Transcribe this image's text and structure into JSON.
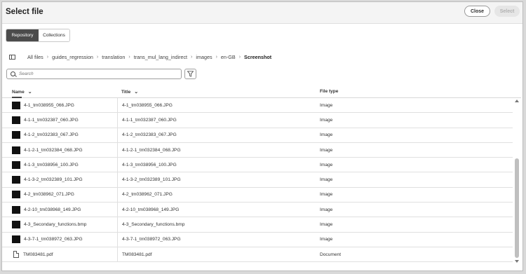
{
  "dialog": {
    "title": "Select file",
    "close_label": "Close",
    "select_label": "Select"
  },
  "tabs": [
    {
      "label": "Repository",
      "active": true
    },
    {
      "label": "Collections",
      "active": false
    }
  ],
  "breadcrumb": [
    "All files",
    "guides_regression",
    "translation",
    "trans_mul_lang_indirect",
    "images",
    "en-GB",
    "Screenshot"
  ],
  "search": {
    "placeholder": "Search",
    "value": ""
  },
  "table": {
    "columns": [
      "Name",
      "Title",
      "File type"
    ],
    "rows": [
      {
        "icon": "image-thumbnail",
        "name": "4-1_tm038955_066.JPG",
        "title": "4-1_tm038955_066.JPG",
        "type": "Image"
      },
      {
        "icon": "image-thumbnail",
        "name": "4-1-1_tm032387_060.JPG",
        "title": "4-1-1_tm032387_060.JPG",
        "type": "Image"
      },
      {
        "icon": "image-thumbnail",
        "name": "4-1-2_tm032383_067.JPG",
        "title": "4-1-2_tm032383_067.JPG",
        "type": "Image"
      },
      {
        "icon": "image-thumbnail",
        "name": "4-1-2-1_tm032384_068.JPG",
        "title": "4-1-2-1_tm032384_068.JPG",
        "type": "Image"
      },
      {
        "icon": "image-thumbnail",
        "name": "4-1-3_tm038956_100.JPG",
        "title": "4-1-3_tm038956_100.JPG",
        "type": "Image"
      },
      {
        "icon": "image-thumbnail",
        "name": "4-1-3-2_tm032389_101.JPG",
        "title": "4-1-3-2_tm032389_101.JPG",
        "type": "Image"
      },
      {
        "icon": "image-thumbnail",
        "name": "4-2_tm038962_071.JPG",
        "title": "4-2_tm038962_071.JPG",
        "type": "Image"
      },
      {
        "icon": "image-thumbnail",
        "name": "4-2-10_tm038968_149.JPG",
        "title": "4-2-10_tm038968_149.JPG",
        "type": "Image"
      },
      {
        "icon": "image-thumbnail",
        "name": "4-3_Secondary_functions.bmp",
        "title": "4-3_Secondary_functions.bmp",
        "type": "Image"
      },
      {
        "icon": "image-thumbnail",
        "name": "4-3-7-1_tm038972_063.JPG",
        "title": "4-3-7-1_tm038972_063.JPG",
        "type": "Image"
      },
      {
        "icon": "document-icon",
        "name": "TM083481.pdf",
        "title": "TM083481.pdf",
        "type": "Document"
      }
    ]
  },
  "colors": {
    "active_tab": "#4b4b4b",
    "header_bg": "#f4f4f4",
    "disabled_button": "#e6e6e6"
  }
}
